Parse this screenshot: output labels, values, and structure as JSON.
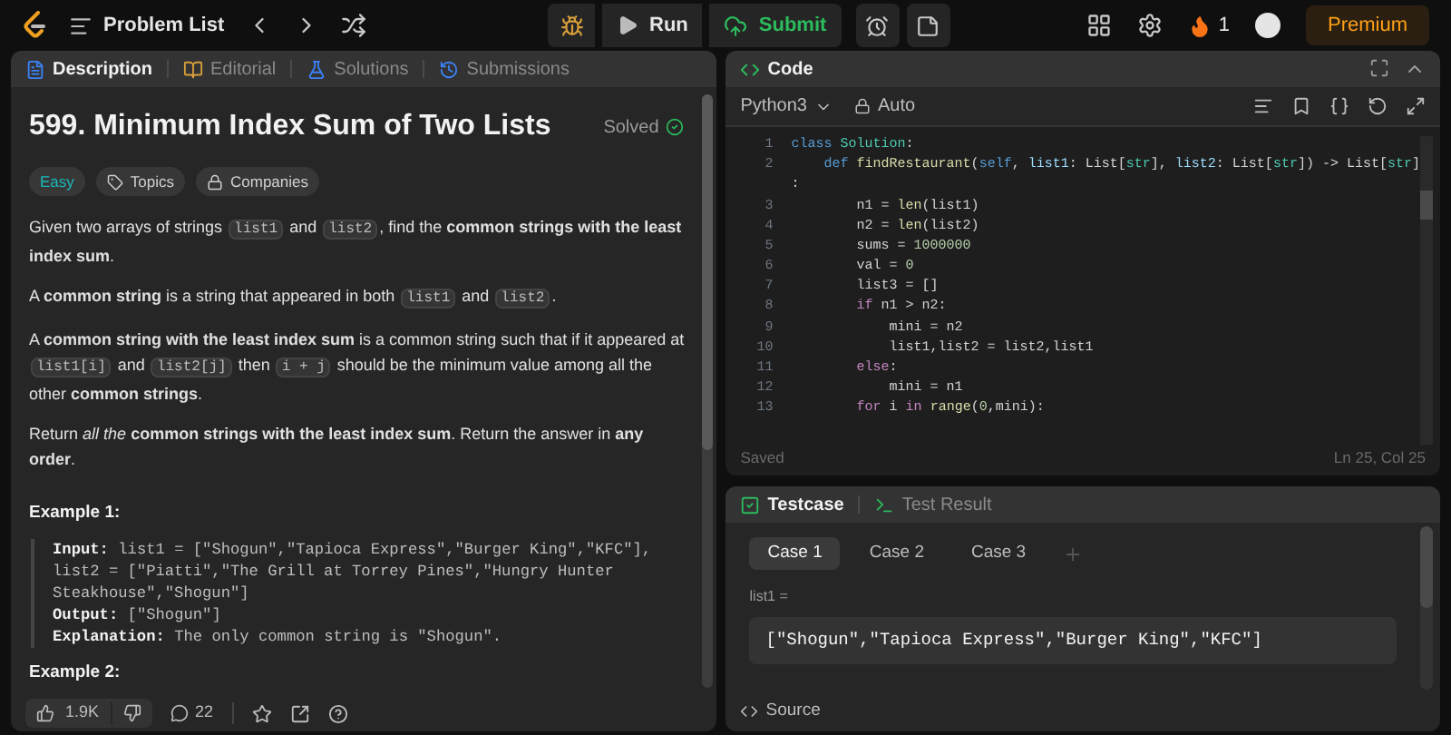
{
  "top_bar": {
    "nav_label": "Problem List",
    "run_label": "Run",
    "submit_label": "Submit",
    "streak": "1",
    "premium_label": "Premium"
  },
  "description_panel": {
    "tabs": [
      {
        "label": "Description",
        "selected": true,
        "kind": "description"
      },
      {
        "label": "Editorial",
        "selected": false,
        "kind": "editorial"
      },
      {
        "label": "Solutions",
        "selected": false,
        "kind": "solutions"
      },
      {
        "label": "Submissions",
        "selected": false,
        "kind": "submissions"
      }
    ],
    "title": "599. Minimum Index Sum of Two Lists",
    "status": "Solved",
    "tags": [
      {
        "label": "Easy",
        "kind": "difficulty"
      },
      {
        "label": "Topics",
        "kind": "topics"
      },
      {
        "label": "Companies",
        "kind": "companies"
      }
    ],
    "paragraphs": [
      [
        {
          "kind": "text",
          "text": "Given two arrays of strings "
        },
        {
          "kind": "code",
          "text": "list1"
        },
        {
          "kind": "text",
          "text": " and "
        },
        {
          "kind": "code",
          "text": "list2"
        },
        {
          "kind": "text",
          "text": ", find the **common strings with the least index sum**."
        }
      ],
      [
        {
          "kind": "text",
          "text": "A **common string** is a string that appeared in both "
        },
        {
          "kind": "code",
          "text": "list1"
        },
        {
          "kind": "text",
          "text": " and "
        },
        {
          "kind": "code",
          "text": "list2"
        },
        {
          "kind": "text",
          "text": "."
        }
      ],
      [
        {
          "kind": "text",
          "text": "A **common string with the least index sum** is a common string such that if it appeared at "
        },
        {
          "kind": "code",
          "text": "list1[i]"
        },
        {
          "kind": "text",
          "text": " and "
        },
        {
          "kind": "code",
          "text": "list2[j]"
        },
        {
          "kind": "text",
          "text": " then "
        },
        {
          "kind": "code",
          "text": "i + j"
        },
        {
          "kind": "text",
          "text": " should be the minimum value among all the other **common strings**."
        }
      ],
      [
        {
          "kind": "text",
          "text": "Return *all the* **common strings with the least index sum**. Return the answer in **any order**."
        }
      ]
    ],
    "examples": [
      {
        "heading": "Example 1:",
        "rows": [
          {
            "label": "Input:",
            "text": "list1 = [\"Shogun\",\"Tapioca Express\",\"Burger King\",\"KFC\"], list2 = [\"Piatti\",\"The Grill at Torrey Pines\",\"Hungry Hunter Steakhouse\",\"Shogun\"]"
          },
          {
            "label": "Output:",
            "text": "[\"Shogun\"]"
          },
          {
            "label": "Explanation:",
            "text": "The only common string is \"Shogun\"."
          }
        ]
      },
      {
        "heading": "Example 2:"
      }
    ],
    "footer": {
      "likes": "1.9K",
      "comments": "22"
    }
  },
  "code_panel": {
    "title": "Code",
    "language": "Python3",
    "mode": "Auto",
    "lines": [
      {
        "number": "1",
        "tokens": [
          {
            "kind": "kw",
            "text": "class"
          },
          {
            "kind": "type",
            "text": " Solution"
          },
          {
            "kind": "plain",
            "text": ":"
          }
        ]
      },
      {
        "number": "2",
        "tokens": [
          {
            "kind": "kw",
            "text": "    def"
          },
          {
            "kind": "fn",
            "text": " findRestaurant"
          },
          {
            "kind": "plain",
            "text": "("
          },
          {
            "kind": "kw",
            "text": "self"
          },
          {
            "kind": "plain",
            "text": ", "
          },
          {
            "kind": "var",
            "text": "list1"
          },
          {
            "kind": "plain",
            "text": ": List["
          },
          {
            "kind": "type",
            "text": "str"
          },
          {
            "kind": "plain",
            "text": "], "
          },
          {
            "kind": "var",
            "text": "list2"
          },
          {
            "kind": "plain",
            "text": ": List["
          },
          {
            "kind": "type",
            "text": "str"
          },
          {
            "kind": "plain",
            "text": "]) -> List["
          },
          {
            "kind": "type",
            "text": "str"
          },
          {
            "kind": "plain",
            "text": "]"
          }
        ]
      },
      {
        "tokens": [
          {
            "kind": "plain",
            "text": ":"
          }
        ]
      },
      {
        "number": "3",
        "tokens": [
          {
            "kind": "plain",
            "text": "        n1 = "
          },
          {
            "kind": "fn",
            "text": "len"
          },
          {
            "kind": "plain",
            "text": "(list1)"
          }
        ]
      },
      {
        "number": "4",
        "tokens": [
          {
            "kind": "plain",
            "text": "        n2 = "
          },
          {
            "kind": "fn",
            "text": "len"
          },
          {
            "kind": "plain",
            "text": "(list2)"
          }
        ]
      },
      {
        "number": "5",
        "tokens": [
          {
            "kind": "plain",
            "text": "        sums = "
          },
          {
            "kind": "num",
            "text": "1000000"
          }
        ]
      },
      {
        "number": "6",
        "tokens": [
          {
            "kind": "plain",
            "text": "        val = "
          },
          {
            "kind": "num",
            "text": "0"
          }
        ]
      },
      {
        "number": "7",
        "tokens": [
          {
            "kind": "plain",
            "text": "        list3 = []"
          }
        ]
      },
      {
        "number": "8",
        "tokens": [
          {
            "kind": "ctl",
            "text": "        if"
          },
          {
            "kind": "plain",
            "text": " n1 > n2:"
          }
        ]
      },
      {
        "number": "9",
        "tokens": [
          {
            "kind": "plain",
            "text": "            mini = n2"
          }
        ]
      },
      {
        "number": "10",
        "tokens": [
          {
            "kind": "plain",
            "text": "            list1,list2 = list2,list1"
          }
        ]
      },
      {
        "number": "11",
        "tokens": [
          {
            "kind": "ctl",
            "text": "        else"
          },
          {
            "kind": "plain",
            "text": ":"
          }
        ]
      },
      {
        "number": "12",
        "tokens": [
          {
            "kind": "plain",
            "text": "            mini = n1"
          }
        ]
      },
      {
        "number": "13",
        "tokens": [
          {
            "kind": "ctl",
            "text": "        for"
          },
          {
            "kind": "plain",
            "text": " i "
          },
          {
            "kind": "ctl",
            "text": "in"
          },
          {
            "kind": "fn",
            "text": " range"
          },
          {
            "kind": "plain",
            "text": "("
          },
          {
            "kind": "num",
            "text": "0"
          },
          {
            "kind": "plain",
            "text": ",mini):"
          }
        ]
      }
    ],
    "status": "Saved",
    "cursor": "Ln 25, Col 25"
  },
  "testcase_panel": {
    "tabs": [
      {
        "label": "Testcase",
        "selected": true,
        "kind": "testcase"
      },
      {
        "label": "Test Result",
        "selected": false,
        "kind": "result"
      }
    ],
    "cases": [
      {
        "label": "Case 1",
        "selected": true
      },
      {
        "label": "Case 2",
        "selected": false
      },
      {
        "label": "Case 3",
        "selected": false
      }
    ],
    "inputs": [
      {
        "label": "list1 =",
        "value": "[\"Shogun\",\"Tapioca Express\",\"Burger King\",\"KFC\"]"
      }
    ],
    "footer": "Source"
  }
}
